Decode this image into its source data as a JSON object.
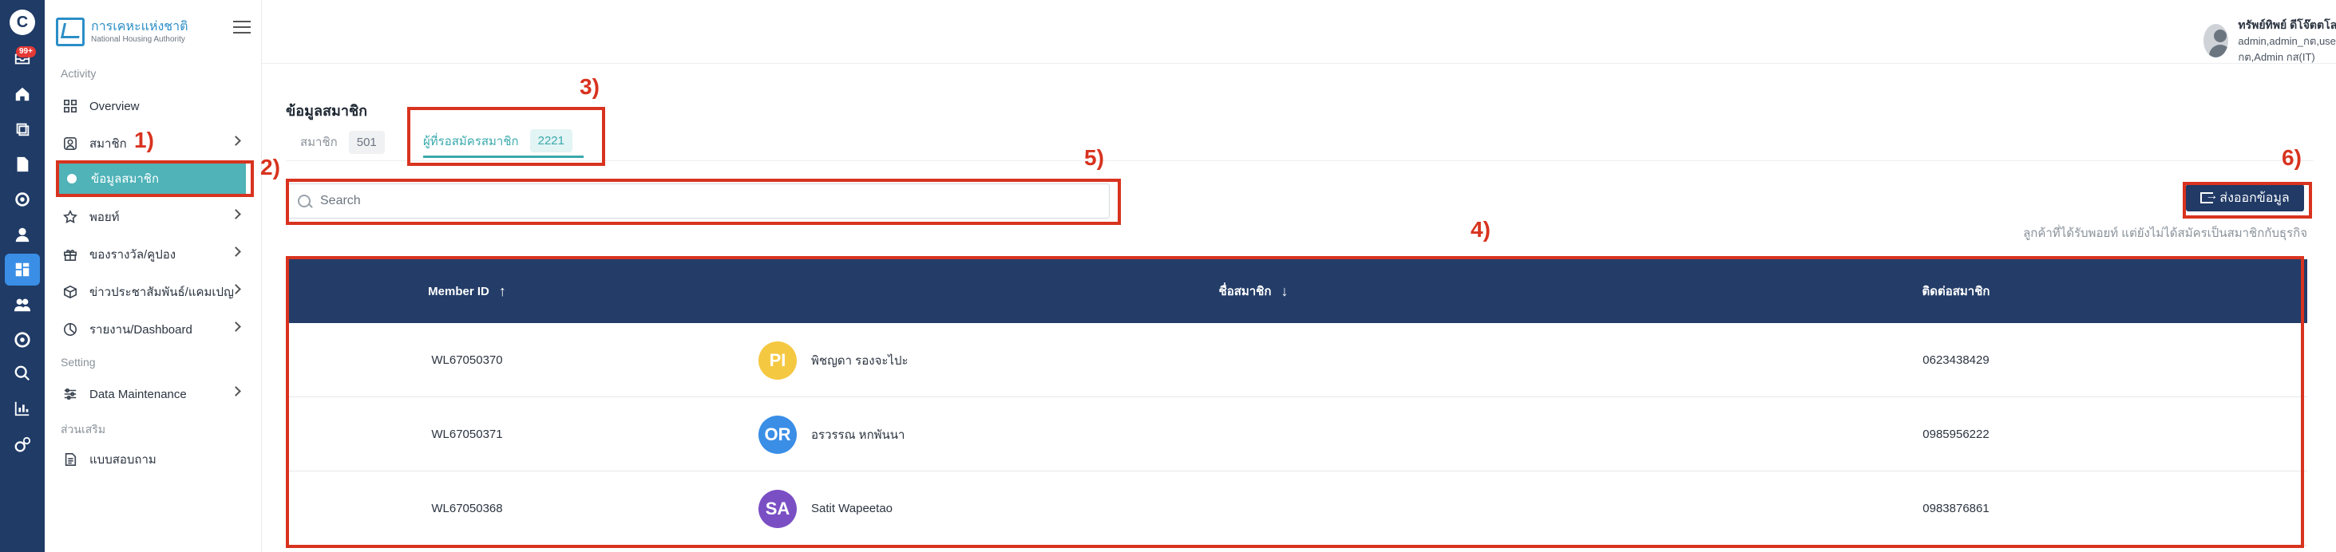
{
  "rail": {
    "logo": "C",
    "badge": "99+",
    "icons": [
      "inbox-icon",
      "home-icon",
      "layers-icon",
      "document-icon",
      "gear-icon",
      "user-icon",
      "dashboard-icon",
      "group-icon",
      "settings-icon",
      "search-icon",
      "chart-icon",
      "cog-icon"
    ]
  },
  "sidebar": {
    "brand_th": "การเคหะแห่งชาติ",
    "brand_en": "National Housing Authority",
    "section_activity": "Activity",
    "section_setting": "Setting",
    "section_extra": "ส่วนเสริม",
    "items": [
      {
        "label": "Overview"
      },
      {
        "label": "สมาชิก"
      },
      {
        "label": "ข้อมูลสมาชิก"
      },
      {
        "label": "พอยท์"
      },
      {
        "label": "ของรางวัล/คูปอง"
      },
      {
        "label": "ข่าวประชาสัมพันธ์/แคมเปญ"
      },
      {
        "label": "รายงาน/Dashboard"
      },
      {
        "label": "Data Maintenance"
      },
      {
        "label": "แบบสอบถาม"
      }
    ]
  },
  "header": {
    "user_name": "ทรัพย์ทิพย์ ดีโจ๊ตตโลก",
    "user_roles": "admin,admin_กต,user_กต,admin_กส,Admin กต,Admin กส(IT)"
  },
  "main": {
    "title": "ข้อมูลสมาชิก",
    "tabs": [
      {
        "label": "สมาชิก",
        "count": "501"
      },
      {
        "label": "ผู้ที่รอสมัครสมาชิก",
        "count": "2221"
      }
    ],
    "search_placeholder": "Search",
    "export_label": "ส่งออกข้อมูล",
    "note": "ลูกค้าที่ได้รับพอยท์ แต่ยังไม่ได้สมัครเป็นสมาชิกกับธุรกิจ",
    "table": {
      "columns": [
        "Member ID",
        "ชื่อสมาชิก",
        "ติดต่อสมาชิก"
      ],
      "rows": [
        {
          "id": "WL67050370",
          "initials": "PI",
          "color": "#f5c842",
          "name": "พิชญดา รองจะไปะ",
          "contact": "0623438429"
        },
        {
          "id": "WL67050371",
          "initials": "OR",
          "color": "#3a8ee6",
          "name": "อรวรรณ หกพันนา",
          "contact": "0985956222"
        },
        {
          "id": "WL67050368",
          "initials": "SA",
          "color": "#7b4fc4",
          "name": "Satit Wapeetao",
          "contact": "0983876861"
        }
      ]
    }
  },
  "annotations": [
    "1)",
    "2)",
    "3)",
    "4)",
    "5)",
    "6)"
  ],
  "colors": {
    "annotation": "#d8331f",
    "primary": "#243d68",
    "teal": "#4fb3b8"
  }
}
